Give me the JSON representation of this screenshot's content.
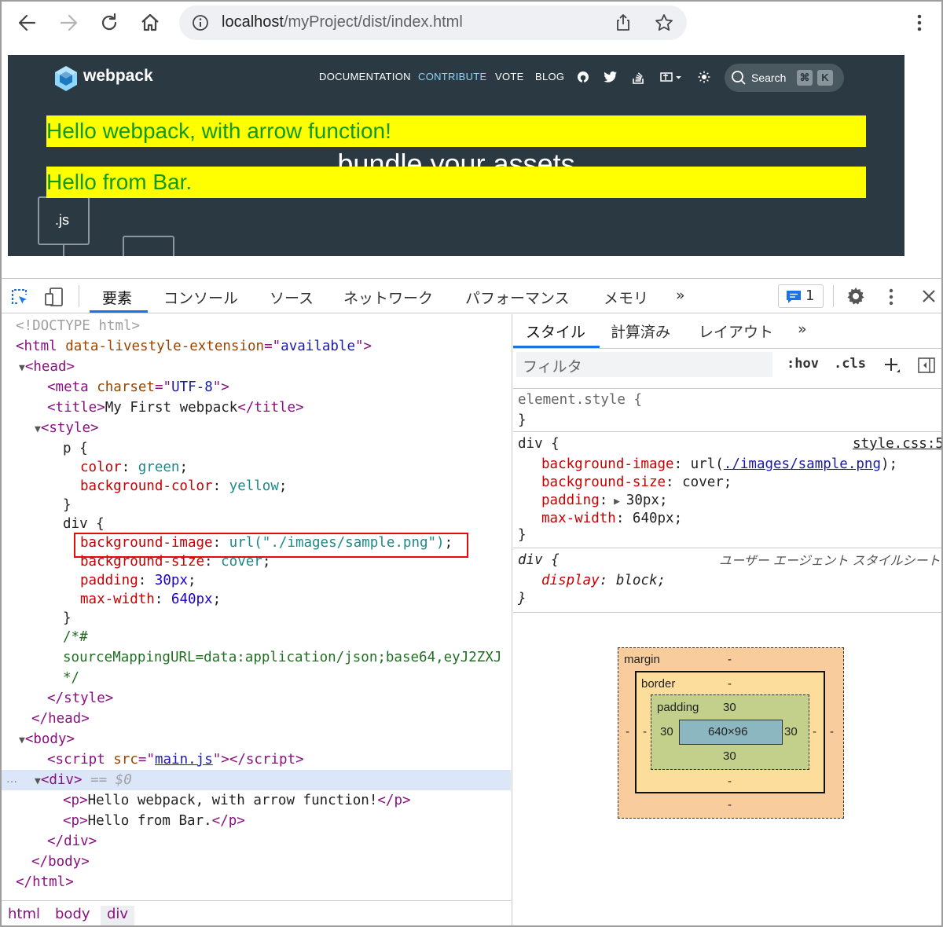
{
  "browser": {
    "url_host": "localhost",
    "url_path": "/myProject/dist/index.html"
  },
  "page": {
    "logo_text": "webpack",
    "nav": [
      "DOCUMENTATION",
      "CONTRIBUTE",
      "VOTE",
      "BLOG"
    ],
    "nav_active_color": "#8dd6f9",
    "search_label": "Search",
    "search_kbd": [
      "⌘",
      "K"
    ],
    "headline": "bundle your assets",
    "p1": "Hello webpack, with arrow function!",
    "p2": "Hello from Bar.",
    "box_label": ".js",
    "bg_color": "#2b3a42",
    "highlight_color": "#ffff00",
    "text_color": "#119a11"
  },
  "devtools": {
    "tabs": [
      "要素",
      "コンソール",
      "ソース",
      "ネットワーク",
      "パフォーマンス",
      "メモリ",
      "»"
    ],
    "issues_count": "1",
    "elements": {
      "doctype": "<!DOCTYPE html>",
      "html_attr_name": "data-livestyle-extension",
      "html_attr_val": "available",
      "meta_attr": "charset",
      "meta_val": "UTF-8",
      "title_text": "My First webpack",
      "css_p_selector": "p {",
      "css_color_prop": "color",
      "css_color_val": "green",
      "css_bg_prop": "background-color",
      "css_bg_val": "yellow",
      "css_div_selector": "div {",
      "css_bgimg_prop": "background-image",
      "css_bgimg_val": "url(\"./images/sample.png\")",
      "css_bgsize_prop": "background-size",
      "css_bgsize_val": "cover",
      "css_padding_prop": "padding",
      "css_padding_val": "30px",
      "css_maxw_prop": "max-width",
      "css_maxw_val": "640px",
      "comment_open": "/*#",
      "comment_body": "sourceMappingURL=data:application/json;base64,eyJ2ZXJ",
      "comment_close": "*/",
      "script_src": "main.js",
      "selected_marker": "== $0",
      "p1_text": "Hello webpack, with arrow function!",
      "p2_text": "Hello from Bar."
    },
    "breadcrumbs": [
      "html",
      "body",
      "div"
    ],
    "styles": {
      "tabs": [
        "スタイル",
        "計算済み",
        "レイアウト",
        "»"
      ],
      "filter_placeholder": "フィルタ",
      "hov": ":hov",
      "cls": ".cls",
      "element_style": "element.style {",
      "rule1_selector": "div {",
      "rule1_source": "style.css:5",
      "rule1_bgimg_prop": "background-image",
      "rule1_bgimg_url": "./images/sample.png",
      "rule1_bgsize_prop": "background-size",
      "rule1_bgsize_val": "cover;",
      "rule1_padding_prop": "padding",
      "rule1_padding_val": "30px;",
      "rule1_maxw_prop": "max-width",
      "rule1_maxw_val": "640px;",
      "rule2_selector": "div {",
      "rule2_source": "ユーザー エージェント スタイルシート",
      "rule2_display_prop": "display",
      "rule2_display_val": "block;"
    },
    "box_model": {
      "margin_label": "margin",
      "margin_top": "-",
      "margin_bottom": "-",
      "margin_left": "-",
      "margin_right": "-",
      "border_label": "border",
      "border_top": "-",
      "border_bottom": "-",
      "border_left": "-",
      "border_right": "-",
      "padding_label": "padding",
      "padding_top": "30",
      "padding_bottom": "30",
      "padding_left": "30",
      "padding_right": "30",
      "content": "640×96"
    }
  }
}
